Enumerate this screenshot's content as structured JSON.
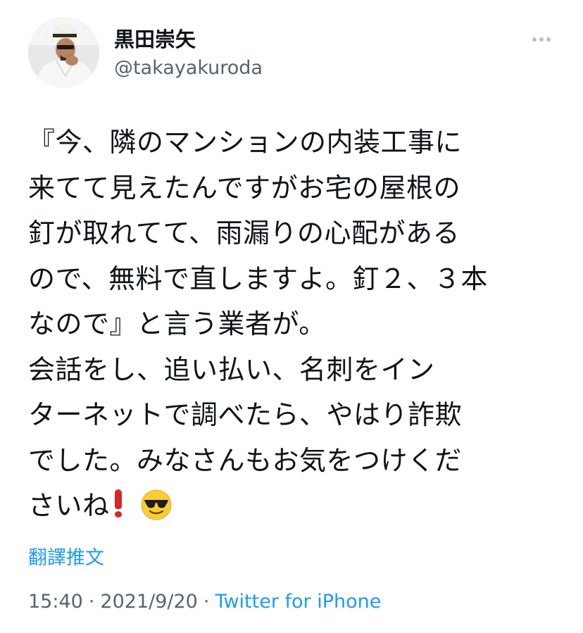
{
  "author": {
    "display_name": "黒田崇矢",
    "handle": "@takayakuroda"
  },
  "tweet": {
    "lines": [
      "『今、隣のマンションの内装工事に",
      "来てて見えたんですがお宅の屋根の",
      "釘が取れてて、雨漏りの心配がある",
      "ので、無料で直しますよ。釘２、３本",
      "なので』と言う業者が。",
      "会話をし、追い払い、名刺をイン",
      "ターネットで調べたら、やはり詐欺",
      "でした。みなさんもお気をつけくだ",
      "さいね"
    ],
    "emojis": [
      "red-exclamation-icon",
      "sunglasses-face-icon"
    ]
  },
  "translate_label": "翻譯推文",
  "meta": {
    "time": "15:40",
    "separator": "·",
    "date": "2021/9/20",
    "source": "Twitter for iPhone"
  },
  "icons": {
    "more": "more-dots-icon"
  },
  "colors": {
    "text": "#0f1419",
    "secondary": "#536471",
    "link": "#1d9bf0",
    "exclamation": "#d8262c",
    "emoji_face": "#ffcc33"
  }
}
